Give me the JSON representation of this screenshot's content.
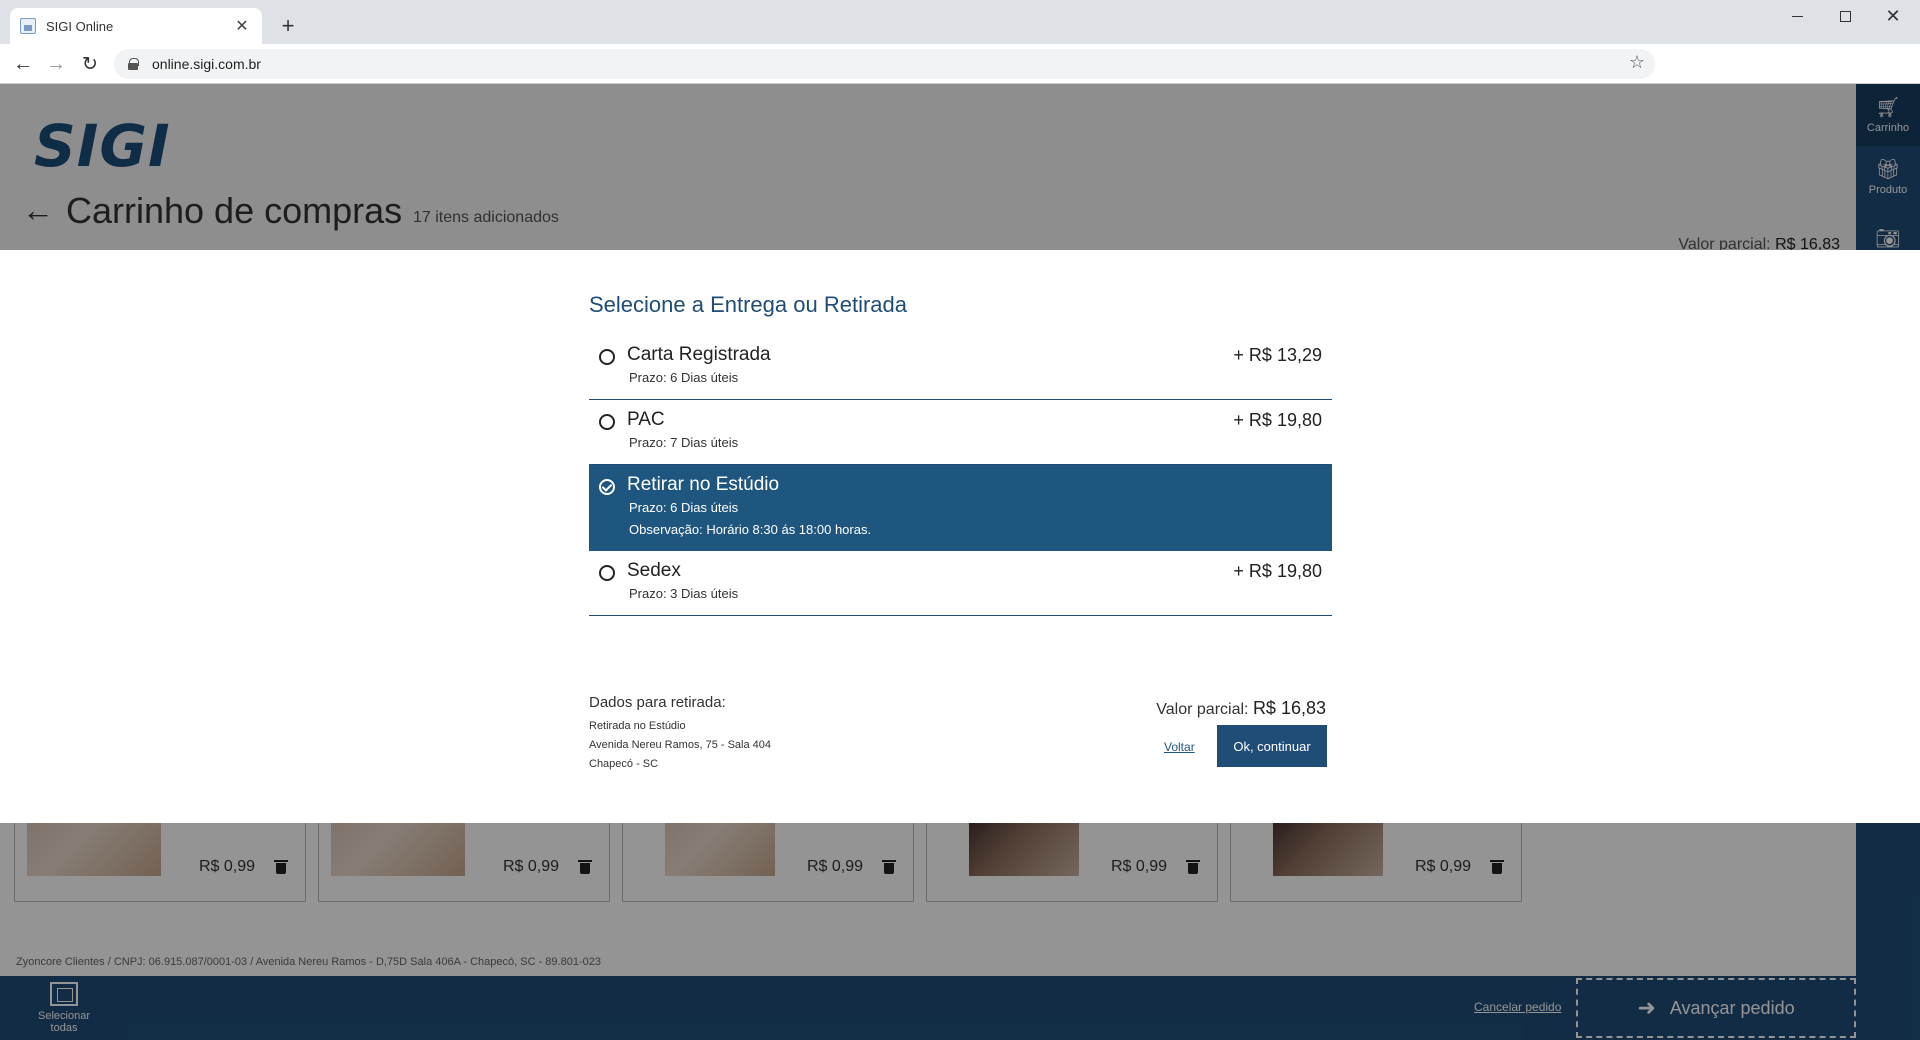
{
  "browser": {
    "tab_title": "SIGI Online",
    "url": "online.sigi.com.br"
  },
  "header": {
    "logo": "SIGI",
    "title": "Carrinho de compras",
    "item_count": "17 itens adicionados",
    "partial_label": "Valor parcial:",
    "partial_value": "R$ 16,83"
  },
  "sidebar": {
    "items": [
      {
        "label": "Carrinho",
        "icon": "cart-icon"
      },
      {
        "label": "Produto",
        "icon": "gift-icon"
      }
    ]
  },
  "products": {
    "cards": [
      {
        "price": "R$ 0,99"
      },
      {
        "price": "R$ 0,99"
      },
      {
        "price": "R$ 0,99"
      },
      {
        "price": "R$ 0,99"
      },
      {
        "price": "R$ 0,99"
      }
    ]
  },
  "footer": {
    "company": "Zyoncore Clientes / CNPJ: 06.915.087/0001-03 / Avenida Nereu Ramos - D,75D Sala 406A - Chapecó, SC - 89.801-023"
  },
  "bottombar": {
    "select_all_line1": "Selecionar",
    "select_all_line2": "todas",
    "cancel": "Cancelar pedido",
    "advance": "Avançar pedido"
  },
  "modal": {
    "title": "Selecione a Entrega ou Retirada",
    "options": [
      {
        "name": "Carta Registrada",
        "price": "+ R$ 13,29",
        "deadline": "Prazo: 6 Dias úteis",
        "selected": false
      },
      {
        "name": "PAC",
        "price": "+ R$ 19,80",
        "deadline": "Prazo: 7 Dias úteis",
        "selected": false
      },
      {
        "name": "Retirar no Estúdio",
        "price": "",
        "deadline": "Prazo: 6 Dias úteis",
        "note": "Observação: Horário 8:30 ás 18:00 horas.",
        "selected": true
      },
      {
        "name": "Sedex",
        "price": "+ R$ 19,80",
        "deadline": "Prazo: 3 Dias úteis",
        "selected": false
      }
    ],
    "pickup": {
      "title": "Dados para retirada:",
      "line1": "Retirada no Estúdio",
      "line2": "Avenida Nereu Ramos, 75 - Sala 404",
      "line3": "Chapecó - SC"
    },
    "partial_label": "Valor parcial:",
    "partial_value": "R$ 16,83",
    "back": "Voltar",
    "ok": "Ok, continuar"
  }
}
